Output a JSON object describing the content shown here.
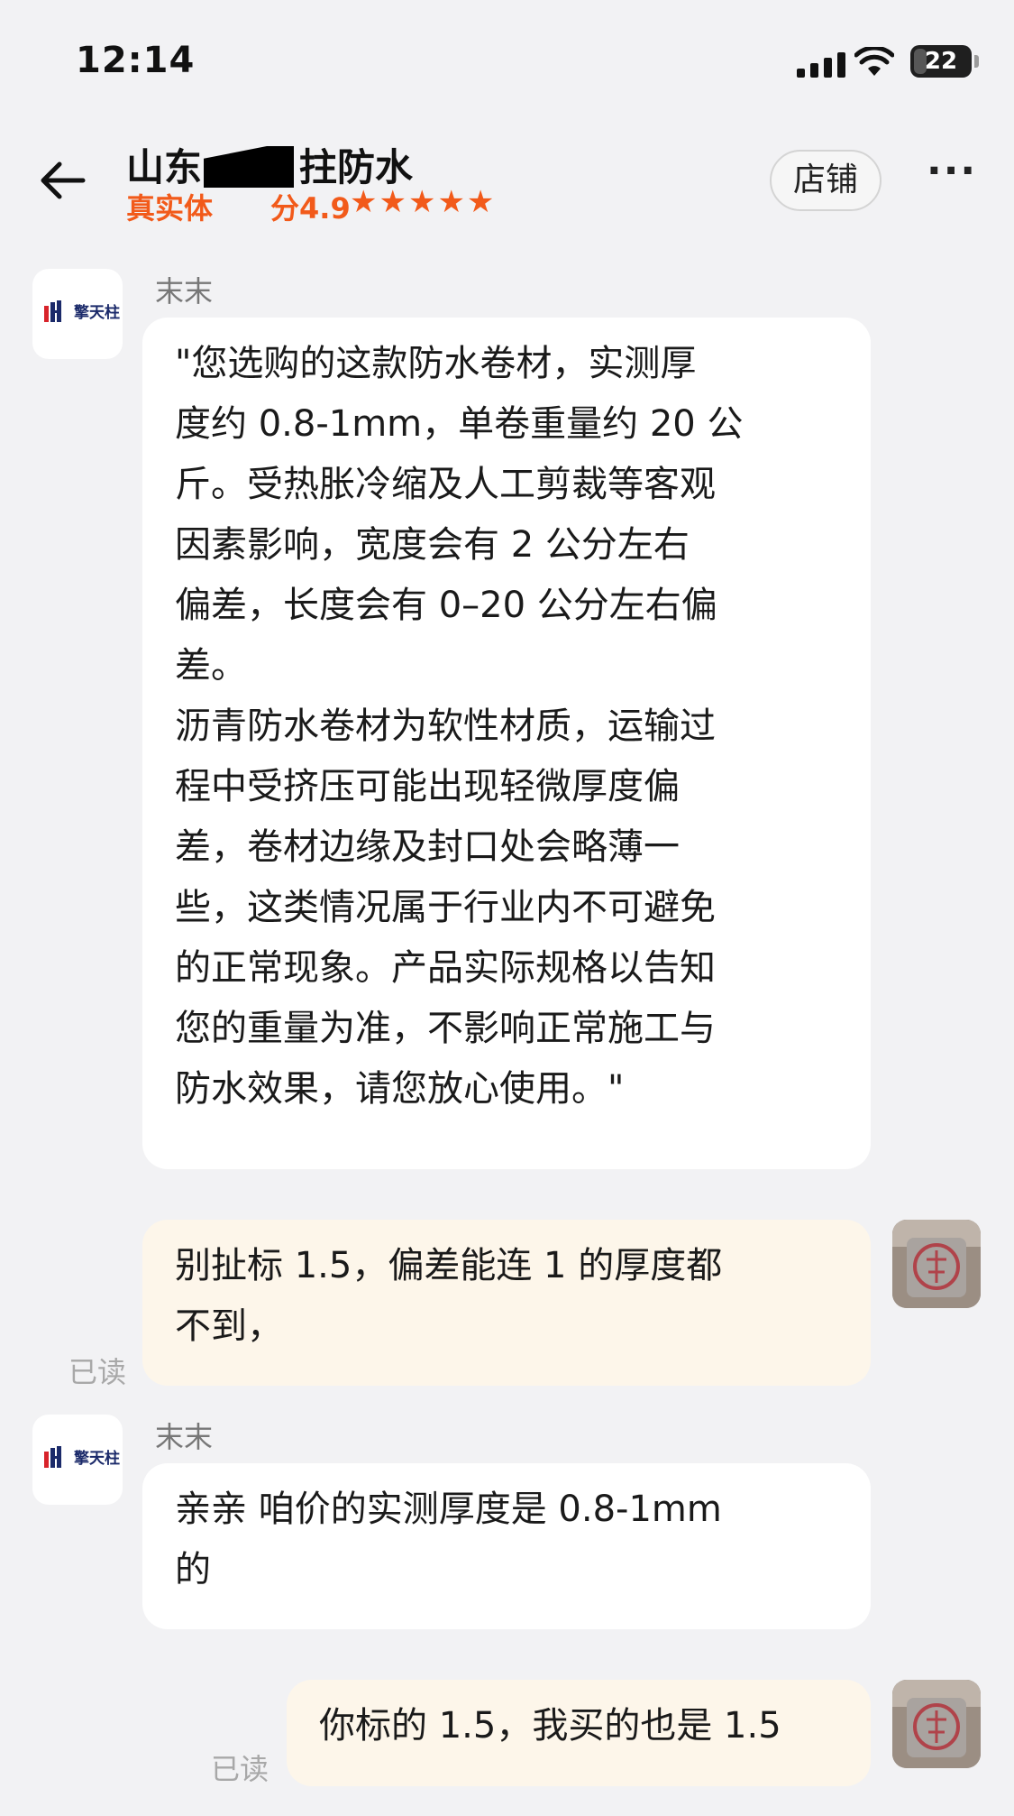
{
  "status_bar": {
    "time": "12:14",
    "battery": "22"
  },
  "header": {
    "shop_name_prefix": "山东",
    "shop_name_suffix": "拄防水",
    "shop_tag": "真实体",
    "rating_prefix": "分",
    "rating": "4.9",
    "stars": "★★★★★",
    "store_button": "店铺",
    "more_label": "···"
  },
  "shop_logo_text": "擎天柱",
  "messages": [
    {
      "sender": "末末",
      "text": "\"您选购的这款防水卷材，实测厚\n度约 0.8-1mm，单卷重量约 20 公\n斤。受热胀冷缩及人工剪裁等客观\n因素影响，宽度会有 2 公分左右\n偏差，长度会有 0–20 公分左右偏\n差。\n沥青防水卷材为软性材质，运输过\n程中受挤压可能出现轻微厚度偏\n差，卷材边缘及封口处会略薄一\n些，这类情况属于行业内不可避免\n的正常现象。产品实际规格以告知\n您的重量为准，不影响正常施工与\n防水效果，请您放心使用。\""
    },
    {
      "text": "别扯标 1.5，偏差能连 1 的厚度都\n不到，",
      "read": "已读"
    },
    {
      "sender": "末末",
      "text": "亲亲 咱价的实测厚度是 0.8-1mm\n的"
    },
    {
      "text": "你标的 1.5，我买的也是 1.5",
      "read": "已读"
    }
  ],
  "colors": {
    "accent": "#f25a1a",
    "background": "#f2f2f4",
    "user_bubble": "#fdf6ea",
    "shop_bubble": "#ffffff"
  }
}
